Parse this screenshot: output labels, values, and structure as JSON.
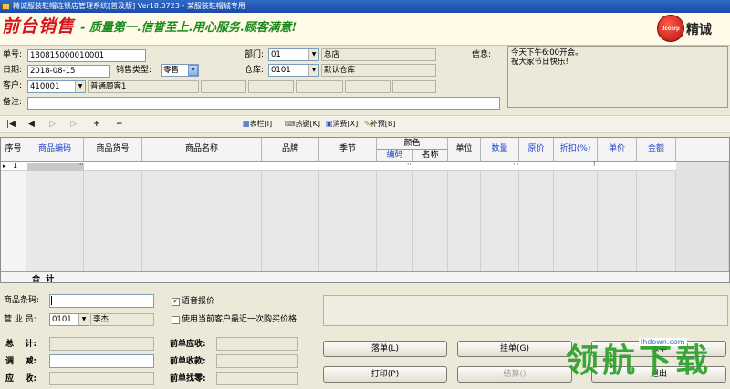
{
  "window": {
    "title": "精诚服装鞋帽连锁店管理系统[普及版] Ver18.0723 - 某服装鞋帽城专用"
  },
  "banner": {
    "slogan_main": "前台销售",
    "slogan_sub": "- 质量第一.信誉至上.用心服务.顾客满意!",
    "logo_mark": "Jcosrp",
    "logo_text": "精诚"
  },
  "form": {
    "order_no_label": "单号:",
    "order_no": "180815000010001",
    "date_label": "日期:",
    "date": "2018-08-15",
    "sale_type_label": "销售类型:",
    "sale_type": "零售",
    "customer_label": "客户:",
    "customer_code": "410001",
    "customer_name": "普通顾客1",
    "remark_label": "备注:",
    "dept_label": "部门:",
    "dept_code": "01",
    "dept_name": "总店",
    "warehouse_label": "仓库:",
    "warehouse_code": "0101",
    "warehouse_name": "默认仓库",
    "info_label": "信息:",
    "info_text": "今天下午6:00开会。\n祝大家节日快乐!"
  },
  "toolbar": {
    "first": "⏮",
    "prev": "◀",
    "next": "▷",
    "last": "⏭",
    "add": "+",
    "remove": "−",
    "table_btn": "表栏[I]",
    "hotkey_btn": "热键[K]",
    "consume_btn": "消费[X]",
    "points_btn": "补预[B]"
  },
  "grid": {
    "headers": {
      "seq": "序号",
      "goods_code": "商品编码",
      "goods_no": "商品货号",
      "goods_name": "商品名称",
      "brand": "品牌",
      "season": "季节",
      "color": "颜色",
      "color_code": "编码",
      "color_name": "名称",
      "unit": "单位",
      "qty": "数量",
      "orig_price": "原价",
      "discount": "折扣(%)",
      "price": "单价",
      "amount": "金额"
    },
    "rows": [
      {
        "seq": "1"
      }
    ],
    "total_label": "合  计"
  },
  "bottom": {
    "barcode_label": "商品条码:",
    "barcode": "",
    "salesman_label": "营 业 员:",
    "salesman_code": "0101",
    "salesman_name": "李杰",
    "voice_price_label": "语音报价",
    "last_price_label": "使用当前客户最近一次购买价格",
    "total_label": "总    计:",
    "adjust_label": "调    减:",
    "receivable_label": "应    收:",
    "prev_receivable_label": "前单应收:",
    "prev_received_label": "前单收款:",
    "prev_change_label": "前单找零:",
    "hold_btn": "落单(L)",
    "suspend_btn": "挂单(G)",
    "print_btn": "打印(P)",
    "settle_btn": "结算()",
    "cancel_btn": "撤单",
    "exit_btn": "退出"
  },
  "watermark": {
    "text": "领航下载",
    "url": "lhdown.com"
  },
  "colors": {
    "title_bar": "#1b4aa8",
    "slogan_red": "#d2141b",
    "slogan_green": "#1a8a1a",
    "header_blue": "#2044c8"
  }
}
